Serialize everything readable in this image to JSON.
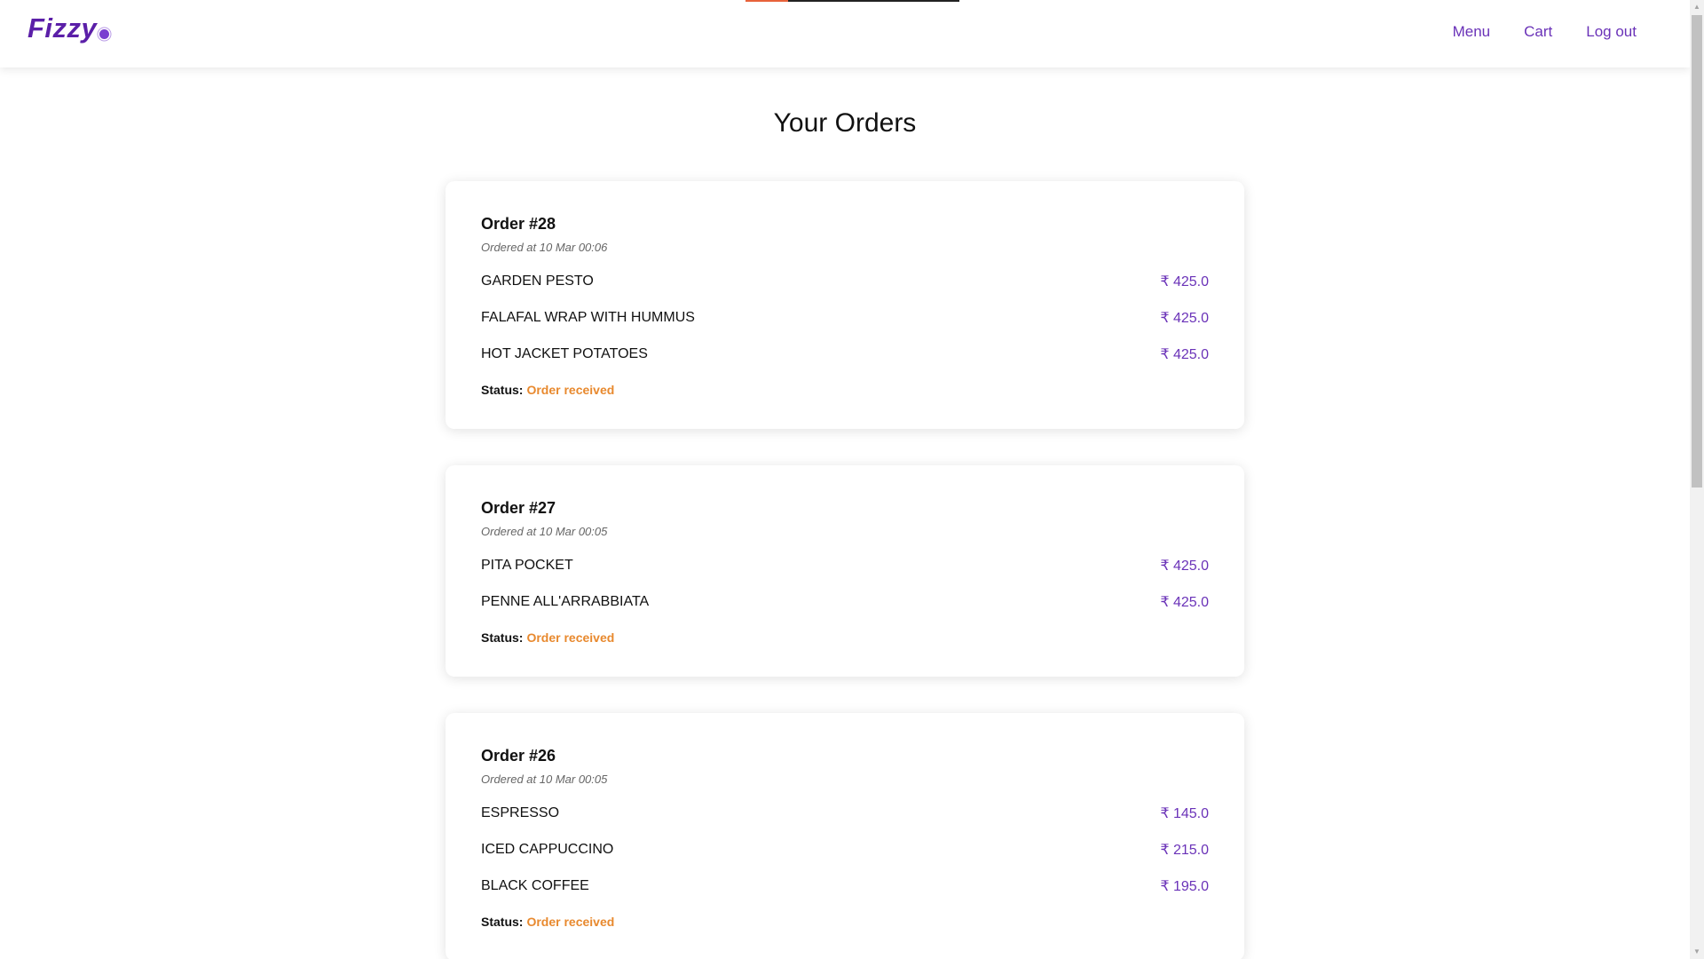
{
  "header": {
    "brand": "Fizzy",
    "nav": [
      {
        "label": "Menu"
      },
      {
        "label": "Cart"
      },
      {
        "label": "Log out"
      }
    ]
  },
  "loading_progress": 0.2,
  "page": {
    "title": "Your Orders"
  },
  "orders": [
    {
      "title": "Order #28",
      "ordered_at": "Ordered at 10 Mar 00:06",
      "items": [
        {
          "name": "GARDEN PESTO",
          "price": "₹ 425.0"
        },
        {
          "name": "FALAFAL WRAP WITH HUMMUS",
          "price": "₹ 425.0"
        },
        {
          "name": "HOT JACKET POTATOES",
          "price": "₹ 425.0"
        }
      ],
      "status_label": "Status:",
      "status": "Order received"
    },
    {
      "title": "Order #27",
      "ordered_at": "Ordered at 10 Mar 00:05",
      "items": [
        {
          "name": "PITA POCKET",
          "price": "₹ 425.0"
        },
        {
          "name": "PENNE ALL'ARRABBIATA",
          "price": "₹ 425.0"
        }
      ],
      "status_label": "Status:",
      "status": "Order received"
    },
    {
      "title": "Order #26",
      "ordered_at": "Ordered at 10 Mar 00:05",
      "items": [
        {
          "name": "ESPRESSO",
          "price": "₹ 145.0"
        },
        {
          "name": "ICED CAPPUCCINO",
          "price": "₹ 215.0"
        },
        {
          "name": "BLACK COFFEE",
          "price": "₹ 195.0"
        }
      ],
      "status_label": "Status:",
      "status": "Order received"
    }
  ],
  "colors": {
    "brand": "#5b1fa8",
    "link": "#6a32b8",
    "price": "#6a32b8",
    "status": "#e8892e",
    "loader": "#e8623a"
  },
  "icons": {
    "scroll_up": "triangle-up-icon",
    "scroll_down": "triangle-down-icon",
    "brand_dot": "dot-icon"
  }
}
